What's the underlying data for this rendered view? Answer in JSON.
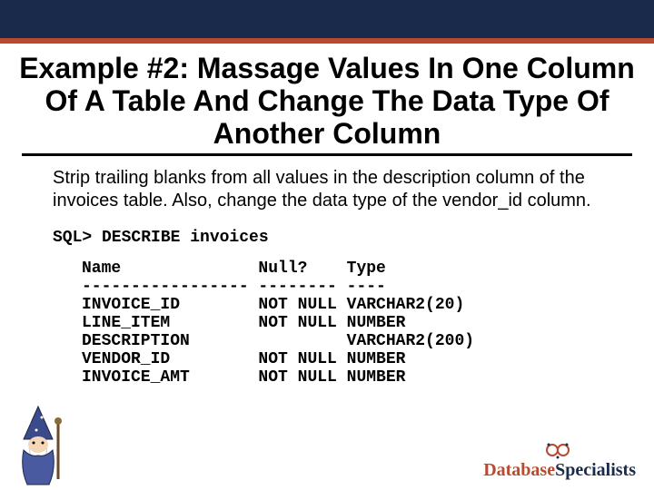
{
  "title": "Example #2: Massage Values In One Column Of A Table And Change The Data Type Of Another Column",
  "body": "Strip trailing blanks from all values in the description column of the invoices table. Also, change the data type of the vendor_id column.",
  "sql_command": "SQL> DESCRIBE invoices",
  "describe_output": "Name              Null?    Type\n----------------- -------- ----\nINVOICE_ID        NOT NULL VARCHAR2(20)\nLINE_ITEM         NOT NULL NUMBER\nDESCRIPTION                VARCHAR2(200)\nVENDOR_ID         NOT NULL NUMBER\nINVOICE_AMT       NOT NULL NUMBER",
  "logo": {
    "brand1": "Database",
    "brand2": "Specialists"
  }
}
